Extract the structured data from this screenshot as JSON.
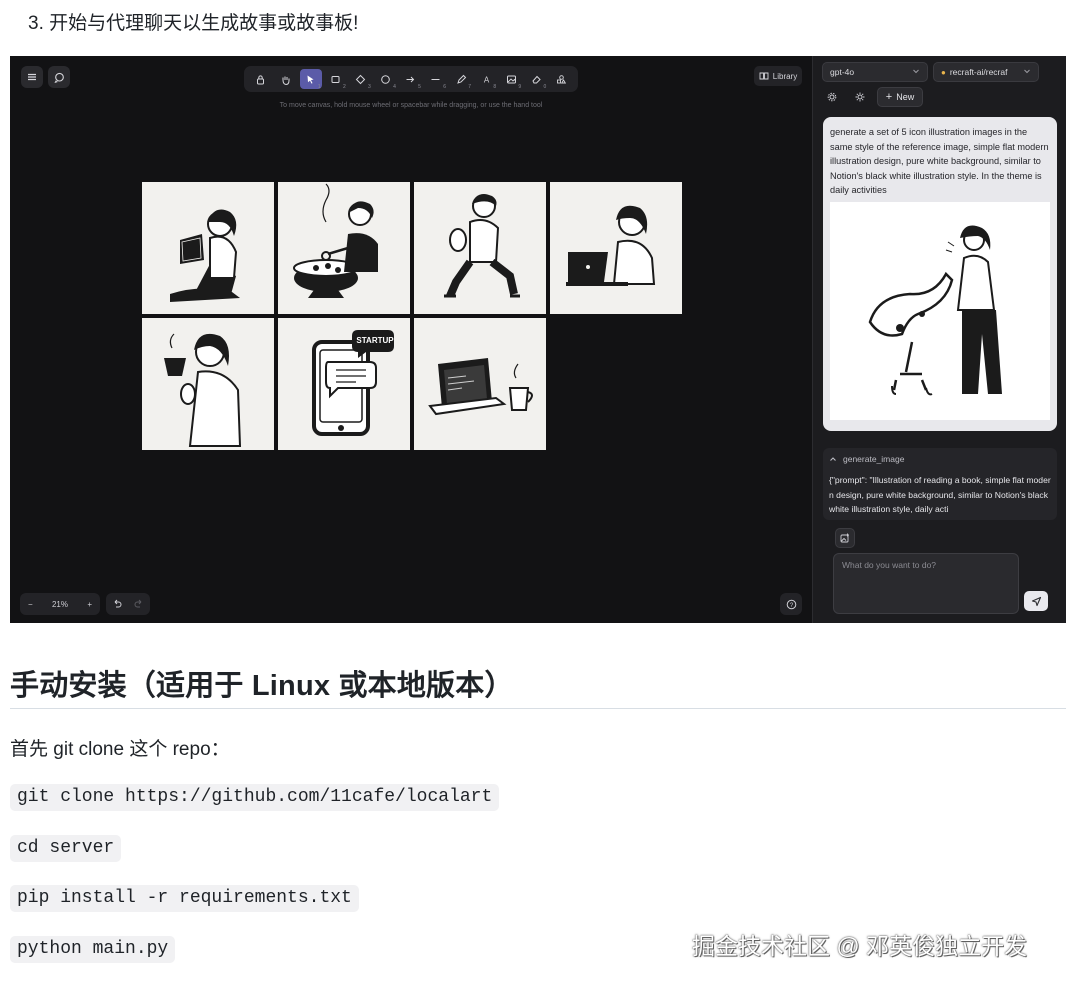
{
  "step_heading": "3. 开始与代理聊天以生成故事或故事板!",
  "app": {
    "toolbar_tools": [
      {
        "icon": "lock-icon",
        "num": ""
      },
      {
        "icon": "hand-icon",
        "num": ""
      },
      {
        "icon": "cursor-icon",
        "num": "1"
      },
      {
        "icon": "rectangle-icon",
        "num": "2"
      },
      {
        "icon": "diamond-icon",
        "num": "3"
      },
      {
        "icon": "ellipse-icon",
        "num": "4"
      },
      {
        "icon": "arrow-icon",
        "num": "5"
      },
      {
        "icon": "line-icon",
        "num": "6"
      },
      {
        "icon": "pencil-icon",
        "num": "7"
      },
      {
        "icon": "text-icon",
        "num": "8"
      },
      {
        "icon": "image-icon",
        "num": "9"
      },
      {
        "icon": "eraser-icon",
        "num": "0"
      },
      {
        "icon": "shapes-icon",
        "num": ""
      }
    ],
    "canvas_hint": "To move canvas, hold mouse wheel or spacebar while dragging, or use the hand tool",
    "library_label": "Library",
    "zoom": {
      "minus": "−",
      "value": "21%",
      "plus": "+"
    },
    "tiles": [
      "reading-book-illustration",
      "cooking-illustration",
      "walking-with-food-illustration",
      "laptop-work-illustration",
      "coffee-drinking-illustration",
      "startup-phone-illustration",
      "laptop-coffee-illustration"
    ],
    "chat": {
      "model_select": "gpt-4o",
      "image_model_select": "recraft-ai/recraf",
      "new_button": "New",
      "user_message": "generate a set of 5 icon illustration images in the same style of the reference image, simple flat modern illustration design, pure white background, similar to Notion's black white illustration style. In the theme is daily activities",
      "tool_name": "generate_image",
      "tool_output": "{\"prompt\": \"Illustration of reading a book, simple flat modern design, pure white background, similar to Notion's black white illustration style, daily acti",
      "input_placeholder": "What do you want to do?"
    }
  },
  "section_heading": "手动安装（适用于 Linux 或本地版本）",
  "intro": "首先 git clone 这个 repo：",
  "code_lines": [
    "git clone https://github.com/11cafe/localart",
    "cd server",
    "pip install -r requirements.txt",
    "python main.py"
  ],
  "watermark": "掘金技术社区 @ 邓英俊独立开发"
}
